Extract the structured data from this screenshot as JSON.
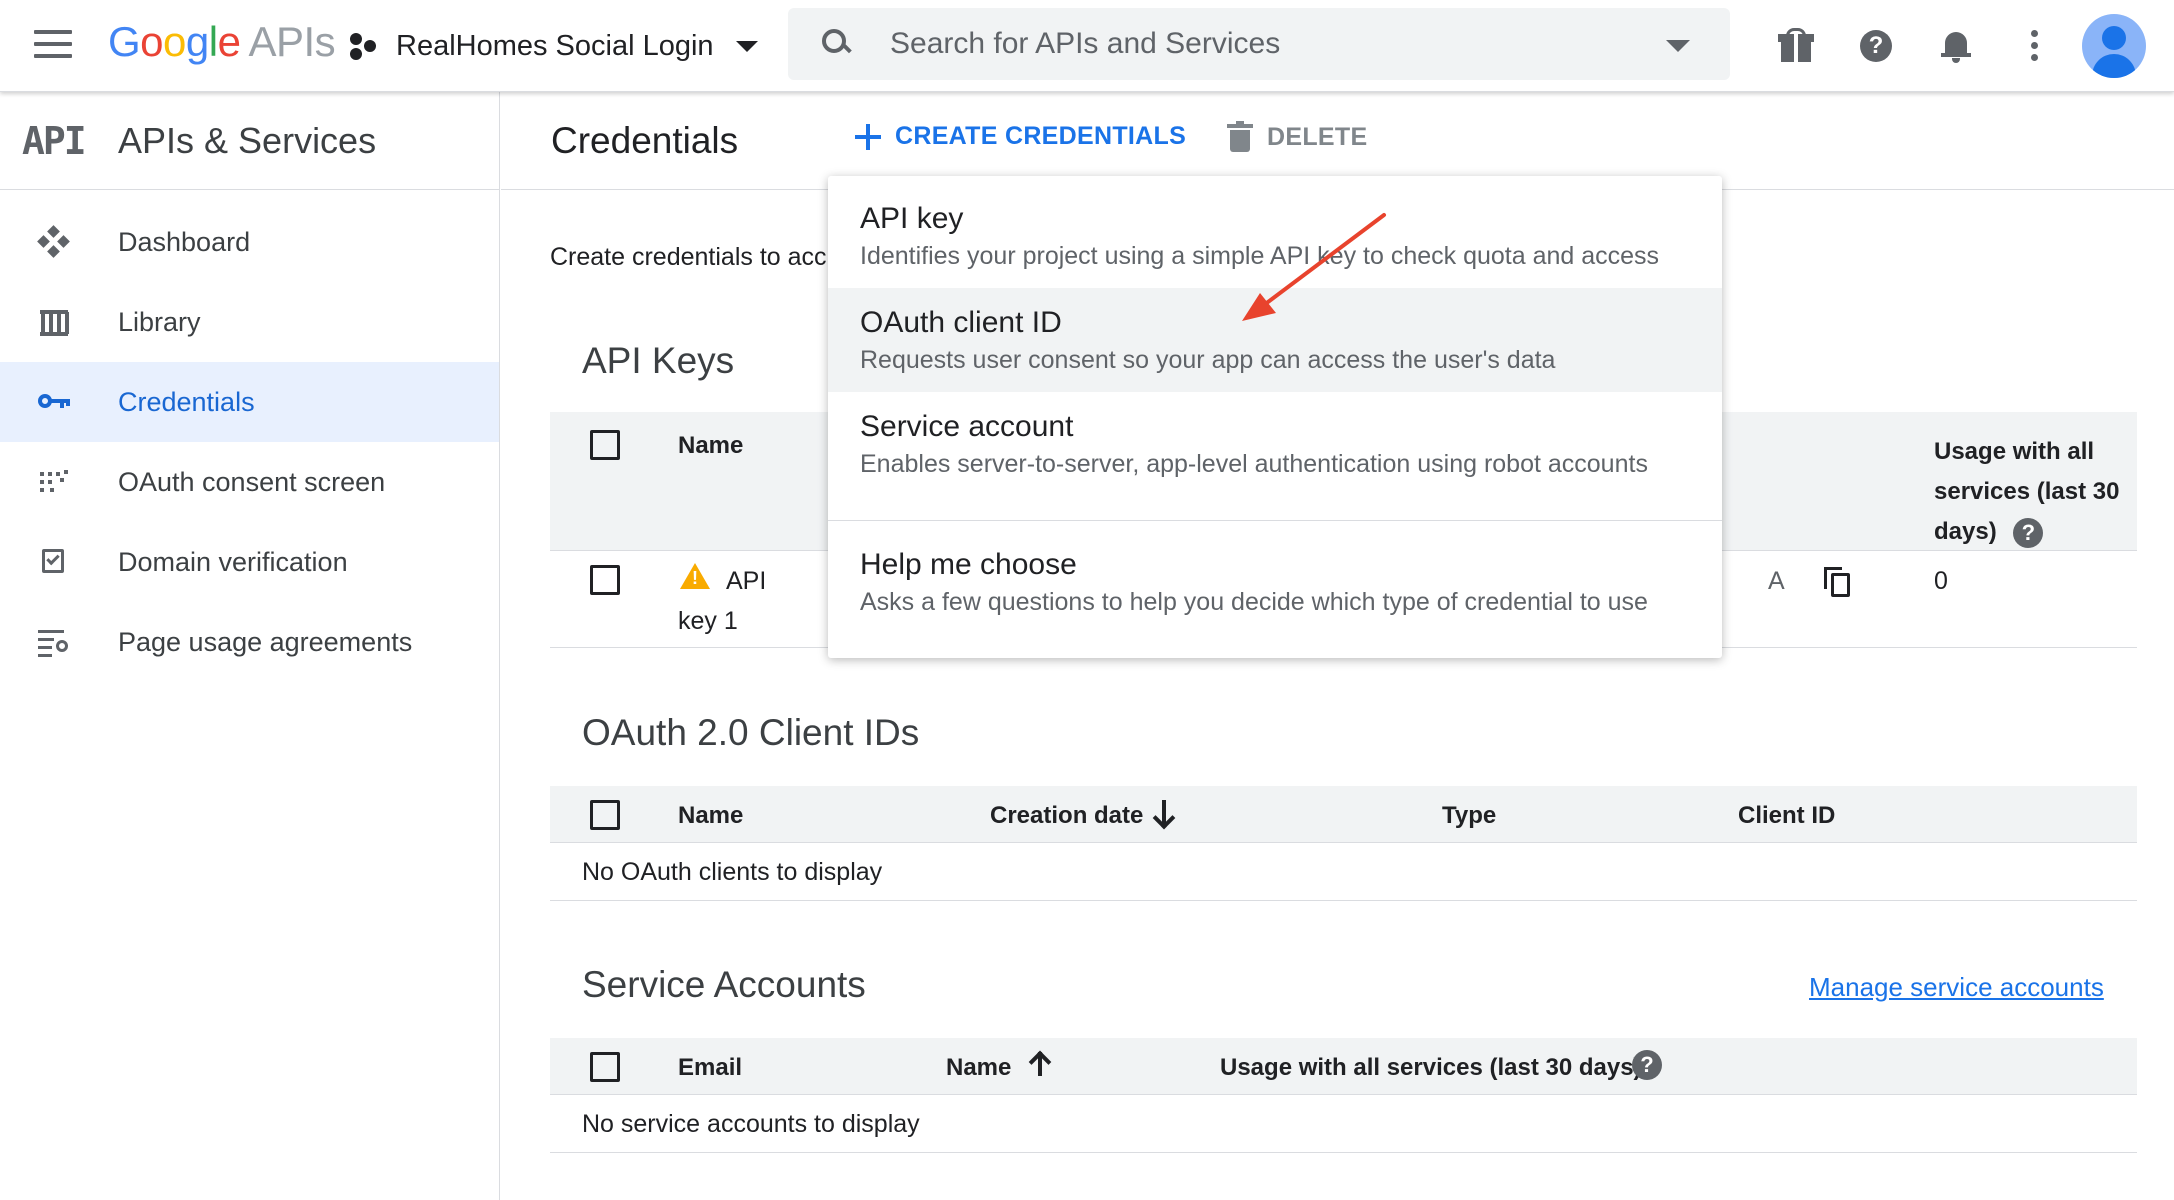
{
  "topbar": {
    "logo_letters": [
      "G",
      "o",
      "o",
      "g",
      "l",
      "e"
    ],
    "logo_suffix": "APIs",
    "project_name": "RealHomes Social Login",
    "search_placeholder": "Search for APIs and Services",
    "icons": [
      "menu-icon",
      "project-icon",
      "search-icon",
      "gift-icon",
      "help-icon",
      "notifications-icon",
      "more-vert-icon",
      "account-avatar"
    ]
  },
  "sidebar": {
    "logo": "API",
    "title": "APIs & Services",
    "items": [
      {
        "label": "Dashboard",
        "icon": "dashboard-icon",
        "active": false
      },
      {
        "label": "Library",
        "icon": "library-icon",
        "active": false
      },
      {
        "label": "Credentials",
        "icon": "key-icon",
        "active": true
      },
      {
        "label": "OAuth consent screen",
        "icon": "oauth-consent-icon",
        "active": false
      },
      {
        "label": "Domain verification",
        "icon": "domain-verification-icon",
        "active": false
      },
      {
        "label": "Page usage agreements",
        "icon": "page-usage-icon",
        "active": false
      }
    ]
  },
  "main": {
    "title": "Credentials",
    "create_label": "CREATE CREDENTIALS",
    "delete_label": "DELETE",
    "intro": "Create credentials to acc",
    "api_keys": {
      "title": "API Keys",
      "headers": {
        "name": "Name",
        "usage": [
          "Usage with all",
          "services (last 30",
          "days)"
        ]
      },
      "rows": [
        {
          "name_line1": "API",
          "name_line2": "key 1",
          "partial": "A",
          "usage": "0"
        }
      ]
    },
    "oauth": {
      "title": "OAuth 2.0 Client IDs",
      "headers": {
        "name": "Name",
        "creation_date": "Creation date",
        "type": "Type",
        "client_id": "Client ID"
      },
      "empty": "No OAuth clients to display"
    },
    "service_accounts": {
      "title": "Service Accounts",
      "manage_link": "Manage service accounts",
      "headers": {
        "email": "Email",
        "name": "Name",
        "usage": "Usage with all services (last 30 days)"
      },
      "empty": "No service accounts to display"
    }
  },
  "menu": {
    "items": [
      {
        "title": "API key",
        "desc": "Identifies your project using a simple API key to check quota and access"
      },
      {
        "title": "OAuth client ID",
        "desc": "Requests user consent so your app can access the user's data"
      },
      {
        "title": "Service account",
        "desc": "Enables server-to-server, app-level authentication using robot accounts"
      },
      {
        "title": "Help me choose",
        "desc": "Asks a few questions to help you decide which type of credential to use"
      }
    ],
    "highlighted_index": 1
  },
  "colors": {
    "accent": "#1a73e8",
    "active_bg": "#e8f0fe",
    "annotation_arrow": "#e8432d",
    "warning": "#f9ab00"
  }
}
